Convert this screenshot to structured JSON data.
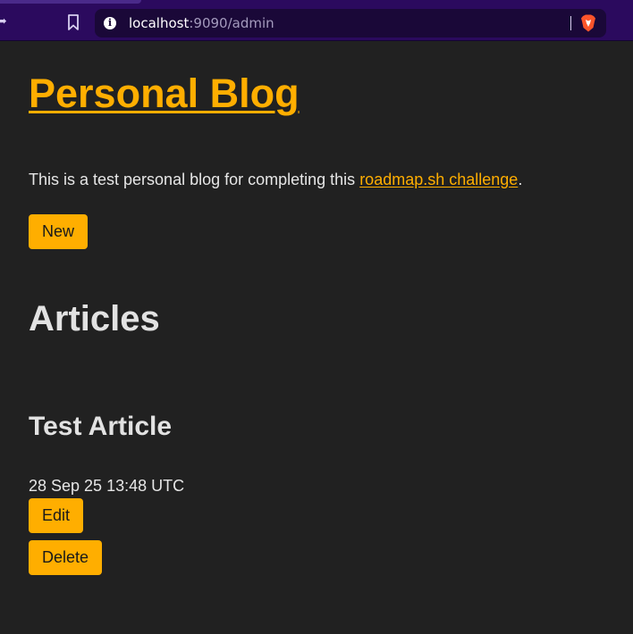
{
  "browser": {
    "url_host": "localhost",
    "url_rest": ":9090/admin",
    "icons": [
      "back-arrow-icon",
      "bookmark-icon",
      "site-info-icon",
      "brave-shield-icon"
    ],
    "colors": {
      "toolbar": "#2b0a5e",
      "url_box": "#1a0838",
      "brave": "#fb542b"
    }
  },
  "page": {
    "site_title": "Personal Blog",
    "intro_before": "This is a test personal blog for completing this ",
    "intro_link": "roadmap.sh challenge",
    "intro_after": ".",
    "new_button": "New",
    "section_heading": "Articles",
    "colors": {
      "background": "#212121",
      "accent": "#ffae00",
      "text": "#e6e6e6"
    }
  },
  "articles": [
    {
      "title": "Test Article",
      "date": "28 Sep 25 13:48 UTC",
      "edit_label": "Edit",
      "delete_label": "Delete"
    }
  ]
}
